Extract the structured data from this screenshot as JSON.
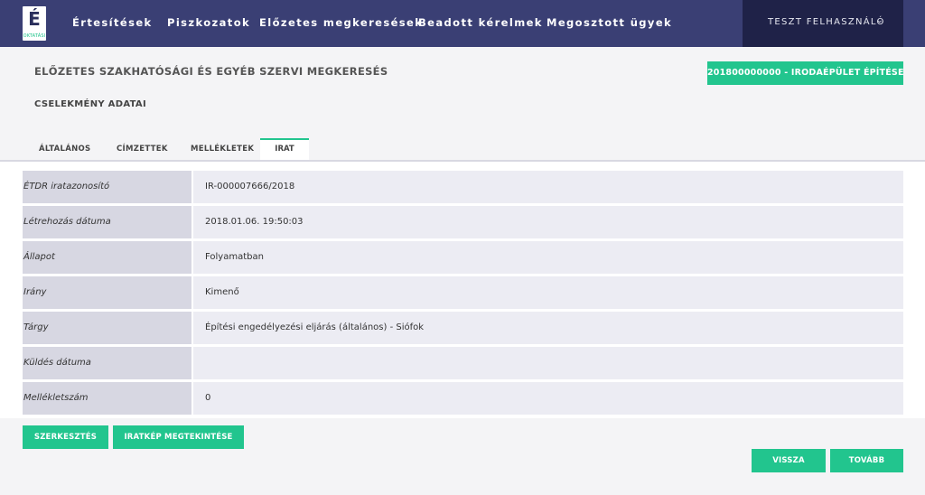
{
  "navbar": {
    "logo_letter": "É",
    "logo_sub": "OKTATÁSI",
    "items": [
      "Értesítések",
      "Piszkozatok",
      "Előzetes megkeresések",
      "Beadott kérelmek",
      "Megosztott ügyek"
    ],
    "user_name": "TESZT FELHASZNÁLÓ",
    "user_chevron": "⌄"
  },
  "header": {
    "title": "ELŐZETES SZAKHATÓSÁGI ÉS EGYÉB SZERVI MEGKERESÉS",
    "case_button": "201800000000 - IRODAÉPÜLET ÉPÍTÉSE",
    "section_title": "CSELEKMÉNY ADATAI"
  },
  "tabs": [
    {
      "label": "ÁLTALÁNOS"
    },
    {
      "label": "CÍMZETTEK"
    },
    {
      "label": "MELLÉKLETEK"
    },
    {
      "label": "IRAT"
    }
  ],
  "details": [
    {
      "label": "ÉTDR iratazonosító",
      "value": "IR-000007666/2018"
    },
    {
      "label": "Létrehozás dátuma",
      "value": "2018.01.06. 19:50:03"
    },
    {
      "label": "Állapot",
      "value": "Folyamatban"
    },
    {
      "label": "Irány",
      "value": "Kimenő"
    },
    {
      "label": "Tárgy",
      "value": "Építési engedélyezési eljárás (általános) - Siófok"
    },
    {
      "label": "Küldés dátuma",
      "value": ""
    },
    {
      "label": "Mellékletszám",
      "value": "0"
    }
  ],
  "actions": {
    "edit": "SZERKESZTÉS",
    "view_document": "IRATKÉP MEGTEKINTÉSE",
    "back": "VISSZA",
    "next": "TOVÁBB"
  },
  "colors": {
    "navbar": "#3a3f74",
    "user_box": "#1f2248",
    "accent": "#22c58e",
    "label_bg": "#d7d7e2",
    "value_bg": "#ececf3"
  }
}
